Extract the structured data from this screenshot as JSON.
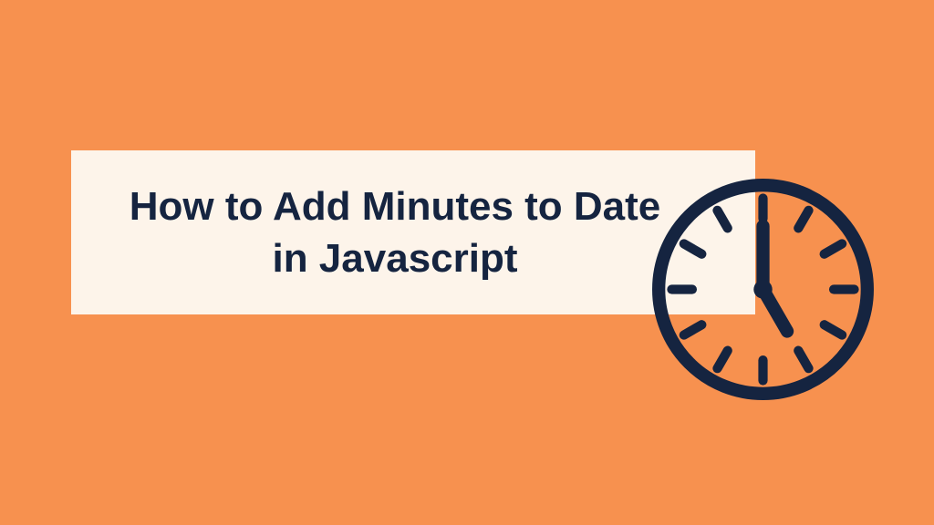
{
  "title": "How to Add Minutes to Date in Javascript",
  "colors": {
    "background": "#f7914f",
    "box": "#fdf4ea",
    "text": "#152440",
    "clock": "#152440"
  }
}
